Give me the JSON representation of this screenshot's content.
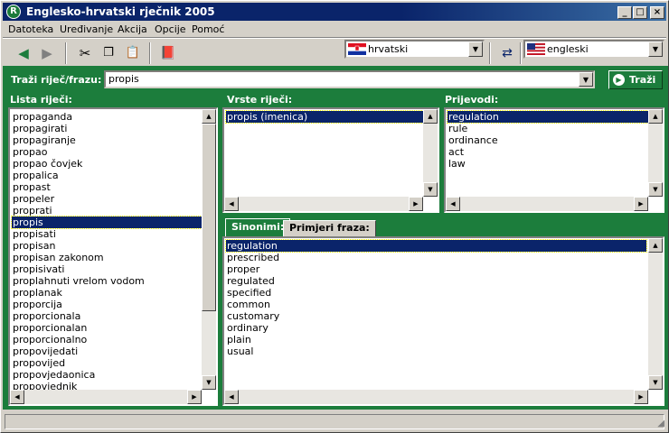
{
  "window": {
    "title": "Englesko-hrvatski rječnik 2005",
    "app_icon": "R"
  },
  "menu": [
    "Datoteka",
    "Uređivanje",
    "Akcija",
    "Opcije",
    "Pomoć"
  ],
  "languages": {
    "source": "hrvatski",
    "target": "engleski"
  },
  "search": {
    "label": "Traži riječ/frazu:",
    "value": "propis",
    "button": "Traži"
  },
  "word_list": {
    "label": "Lista riječi:",
    "items": [
      "propaganda",
      "propagirati",
      "propagiranje",
      "propao",
      "propao čovjek",
      "propalica",
      "propast",
      "propeler",
      "proprati",
      "propis",
      "propisati",
      "propisan",
      "propisan zakonom",
      "propisivati",
      "proplahnuti vrelom vodom",
      "proplanak",
      "proporcija",
      "proporcionala",
      "proporcionalan",
      "proporcionalno",
      "propovijedati",
      "propovijed",
      "propovjedaonica",
      "propovjednik"
    ],
    "selected": 9
  },
  "word_types": {
    "label": "Vrste riječi:",
    "items": [
      "propis (imenica)"
    ],
    "selected": 0
  },
  "translations": {
    "label": "Prijevodi:",
    "items": [
      "regulation",
      "rule",
      "ordinance",
      "act",
      "law"
    ],
    "selected": 0
  },
  "tabs": [
    "Sinonimi:",
    "Primjeri fraza:"
  ],
  "synonyms": {
    "items": [
      "regulation",
      "prescribed",
      "proper",
      "regulated",
      "specified",
      "common",
      "customary",
      "ordinary",
      "plain",
      "usual"
    ],
    "selected": 0
  },
  "colors": {
    "panel_green": "#1c7d3c",
    "selection": "#0a246a",
    "title": "#0a246a"
  }
}
